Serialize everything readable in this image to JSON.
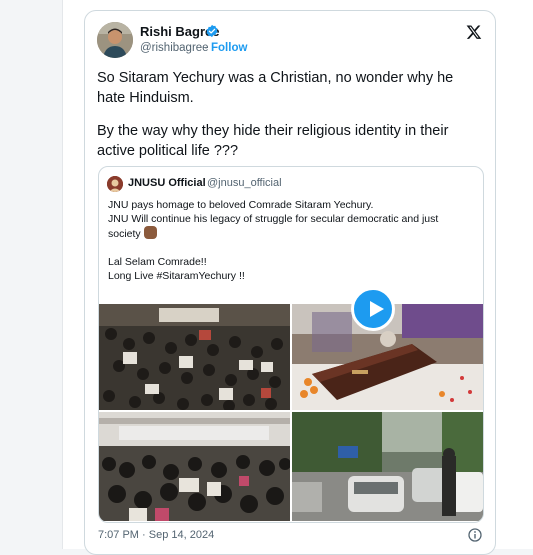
{
  "tweet": {
    "author_name": "Rishi Bagree",
    "author_handle": "@rishibagree",
    "separator": "·",
    "follow_label": "Follow",
    "text_lines": [
      "So Sitaram Yechury was a Christian, no wonder why he",
      "hate Hinduism.",
      "By the way why they hide their religious identity in their",
      "active political life ???"
    ],
    "timestamp": "7:07 PM · Sep 14, 2024"
  },
  "quoted_tweet": {
    "author_name": "JNUSU Official",
    "author_handle": "@jnusu_official",
    "text_lines": [
      "JNU pays homage to beloved Comrade Sitaram Yechury.",
      "JNU Will continue his legacy of struggle for secular democratic and just",
      "society",
      "Lal Selam Comrade!!",
      "Long Live #SitaramYechury !!"
    ]
  },
  "icons": {
    "verified": "verified-badge-icon",
    "x_logo": "x-logo-icon",
    "play": "play-icon",
    "info": "info-icon",
    "emoji": "raised-fist-emoji"
  },
  "colors": {
    "accent": "#1d9bf0",
    "text": "#0f1419",
    "muted": "#536471",
    "border": "#cfd9de"
  }
}
